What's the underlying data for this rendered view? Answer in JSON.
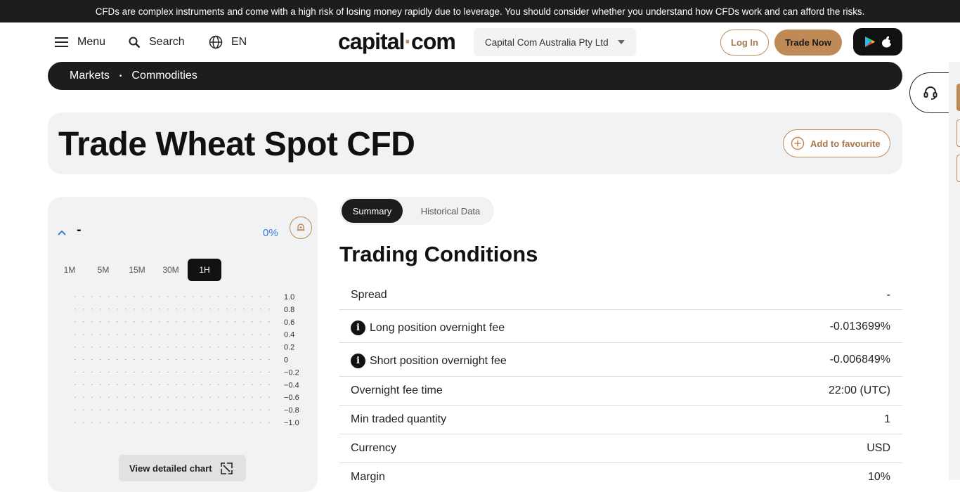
{
  "warning_text": "CFDs are complex instruments and come with a high risk of losing money rapidly due to leverage. You should consider whether you understand how CFDs work and can afford the risks.",
  "header": {
    "menu_label": "Menu",
    "search_label": "Search",
    "lang_label": "EN",
    "logo_left": "capital",
    "logo_dot": "·",
    "logo_right": "com",
    "entity": "Capital Com Australia Pty Ltd",
    "login_label": "Log In",
    "trade_label": "Trade Now"
  },
  "breadcrumb": {
    "items": [
      "Markets",
      "Commodities"
    ],
    "separator": "•"
  },
  "page_title": "Trade Wheat Spot CFD",
  "favourite_label": "Add to favourite",
  "chart_panel": {
    "price": "-",
    "change_pct": "0%",
    "timeframes": [
      "1M",
      "5M",
      "15M",
      "30M",
      "1H"
    ],
    "active_timeframe": "1H",
    "y_ticks": [
      "1.0",
      "0.8",
      "0.6",
      "0.4",
      "0.2",
      "0",
      "−0.2",
      "−0.4",
      "−0.6",
      "−0.8",
      "−1.0"
    ],
    "detail_label": "View detailed chart"
  },
  "tabs": [
    "Summary",
    "Historical Data"
  ],
  "section_title": "Trading Conditions",
  "conditions": [
    {
      "label": "Spread",
      "value": "-",
      "info": false
    },
    {
      "label": "Long position overnight fee",
      "value": "-0.013699%",
      "info": true
    },
    {
      "label": "Short position overnight fee",
      "value": "-0.006849%",
      "info": true
    },
    {
      "label": "Overnight fee time",
      "value": "22:00 (UTC)",
      "info": false
    },
    {
      "label": "Min traded quantity",
      "value": "1",
      "info": false
    },
    {
      "label": "Currency",
      "value": "USD",
      "info": false
    },
    {
      "label": "Margin",
      "value": "10%",
      "info": false
    }
  ],
  "colors": {
    "accent": "#c08a56",
    "dark": "#1d1d1f",
    "positive": "#3a7bd5"
  }
}
